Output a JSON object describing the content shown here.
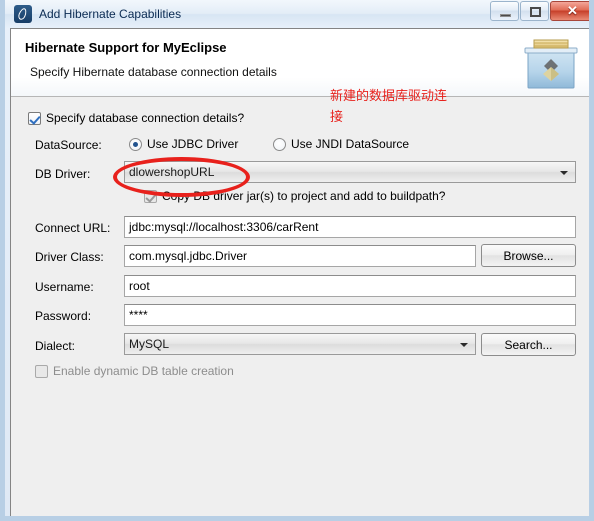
{
  "window": {
    "title": "Add Hibernate Capabilities",
    "icon": "hibernate-icon",
    "controls": {
      "minimize": "minimize-icon",
      "maximize": "maximize-icon",
      "close": "✕"
    }
  },
  "banner": {
    "title": "Hibernate Support for MyEclipse",
    "subtitle": "Specify Hibernate database connection details",
    "icon": "wizard-banner-icon"
  },
  "form": {
    "specify_db_checkbox": {
      "label": "Specify database connection details?",
      "checked": true
    },
    "datasource": {
      "label": "DataSource:",
      "options": [
        {
          "label": "Use JDBC Driver",
          "selected": true
        },
        {
          "label": "Use JNDI DataSource",
          "selected": false
        }
      ]
    },
    "db_driver": {
      "label": "DB Driver:",
      "value": "dlowershopURL"
    },
    "copy_jars_checkbox": {
      "label": "Copy DB driver jar(s) to project and add to buildpath?",
      "checked": true,
      "disabled": true
    },
    "connect_url": {
      "label": "Connect URL:",
      "value": "jdbc:mysql://localhost:3306/carRent"
    },
    "driver_class": {
      "label": "Driver Class:",
      "value": "com.mysql.jdbc.Driver",
      "browse_button": "Browse..."
    },
    "username": {
      "label": "Username:",
      "value": "root"
    },
    "password": {
      "label": "Password:",
      "value": "****"
    },
    "dialect": {
      "label": "Dialect:",
      "value": "MySQL",
      "search_button": "Search..."
    },
    "enable_dynamic_table": {
      "label": "Enable dynamic DB table creation",
      "checked": false
    }
  },
  "annotations": {
    "note_text": "新建的数据库驱动连\n接",
    "note_color": "#e8211c",
    "highlight_ellipse": "red-ellipse-around-db-driver"
  }
}
